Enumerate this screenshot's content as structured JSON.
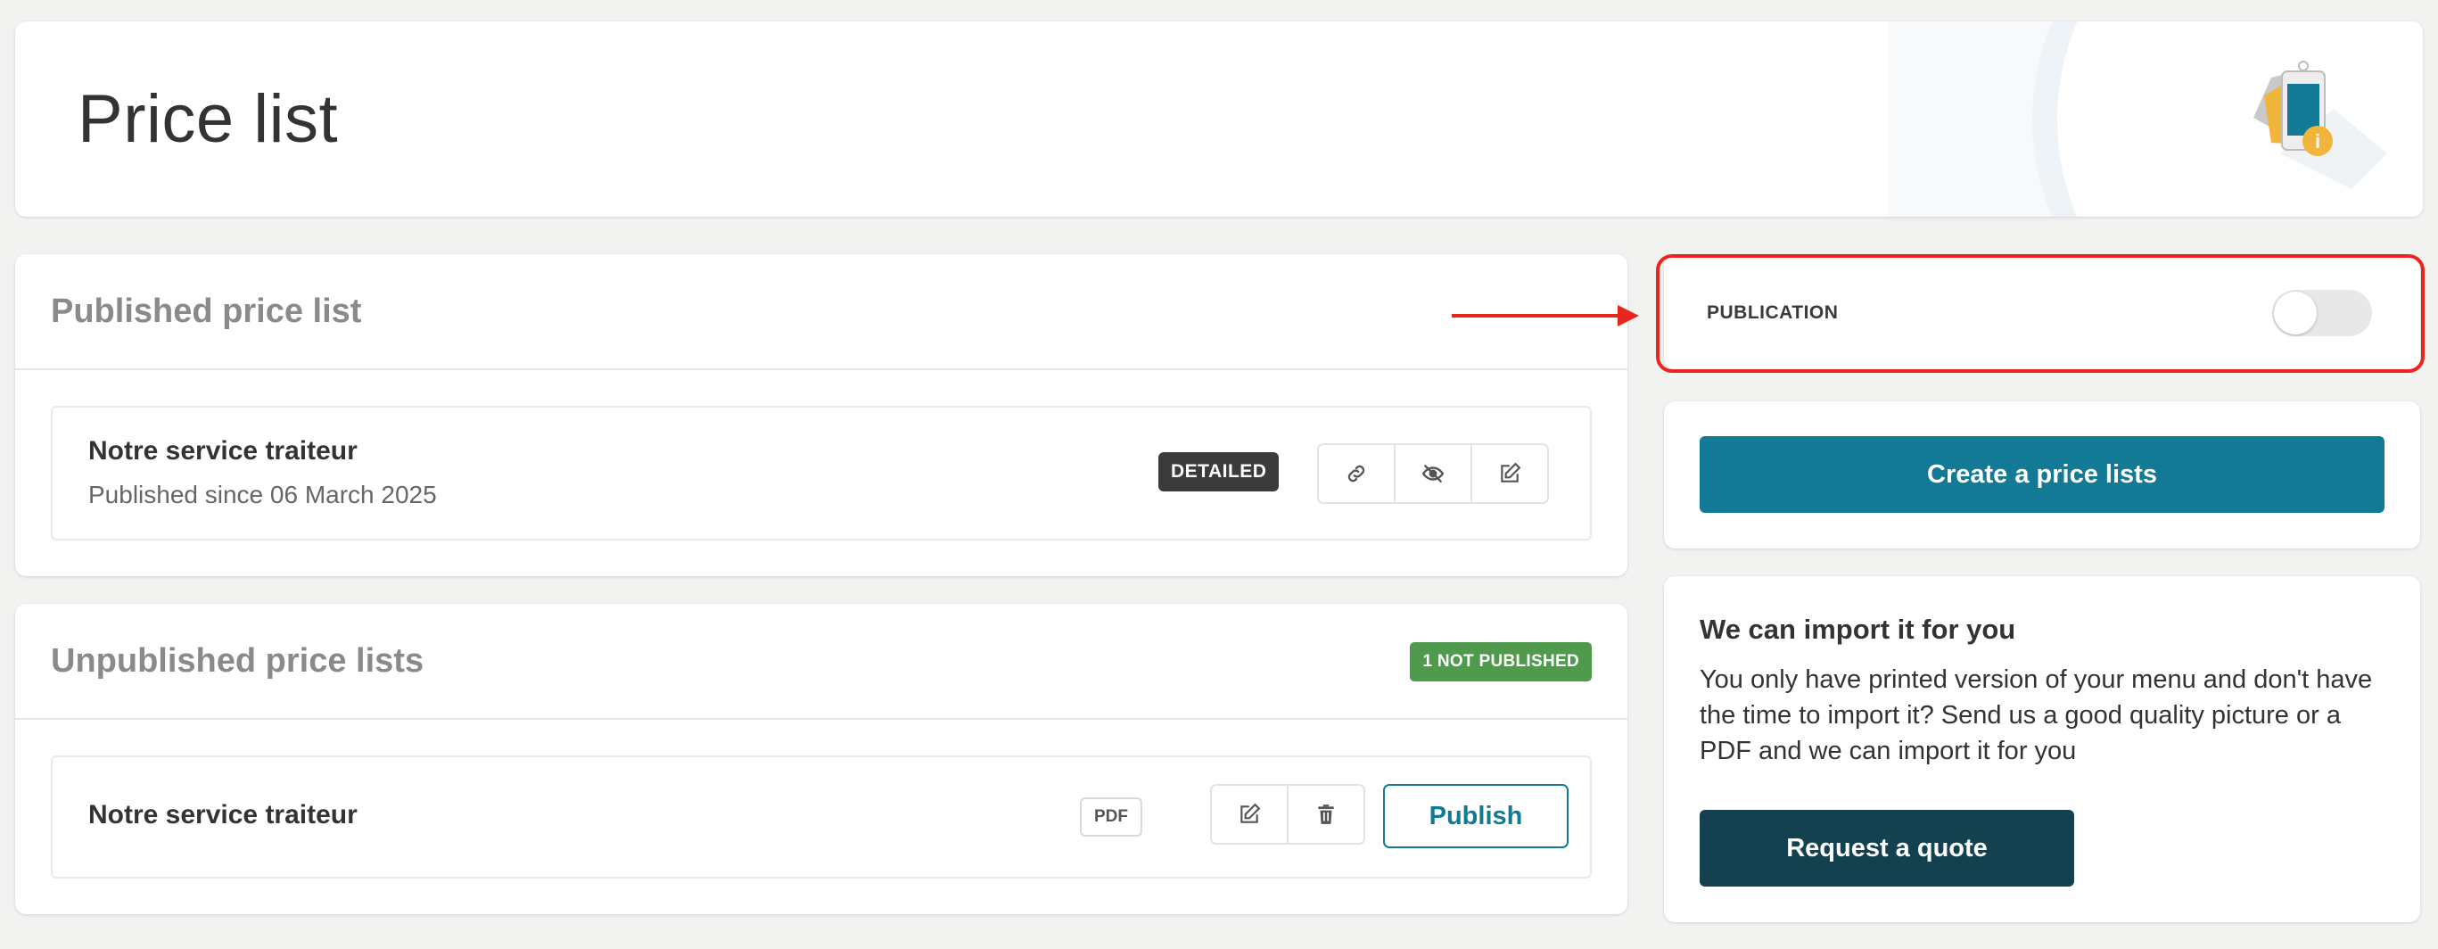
{
  "header": {
    "title": "Price list",
    "illustration_icon": "price-tag-phone-info-icon"
  },
  "published": {
    "title": "Published price list",
    "item": {
      "name": "Notre service traiteur",
      "status": "Published since 06 March 2025",
      "badge": "DETAILED",
      "actions": [
        {
          "icon": "link-icon"
        },
        {
          "icon": "eye-slash-icon"
        },
        {
          "icon": "edit-icon"
        }
      ]
    }
  },
  "unpublished": {
    "title": "Unpublished price lists",
    "count_badge": "1 NOT PUBLISHED",
    "item": {
      "name": "Notre service traiteur",
      "badge": "PDF",
      "actions": [
        {
          "icon": "edit-icon"
        },
        {
          "icon": "trash-icon"
        }
      ],
      "publish_label": "Publish"
    }
  },
  "publication": {
    "label": "PUBLICATION",
    "enabled": false
  },
  "create": {
    "label": "Create a price lists"
  },
  "import": {
    "title": "We can import it for you",
    "text": "You only have printed version of your menu and don't have the time to import it? Send us a good quality picture or a PDF and we can import it for you",
    "button_label": "Request a quote"
  },
  "colors": {
    "primary": "#127a94",
    "dark_button": "#14414f",
    "success_badge": "#4f9a4d",
    "highlight": "#e8261d",
    "background": "#f2f2f1"
  }
}
